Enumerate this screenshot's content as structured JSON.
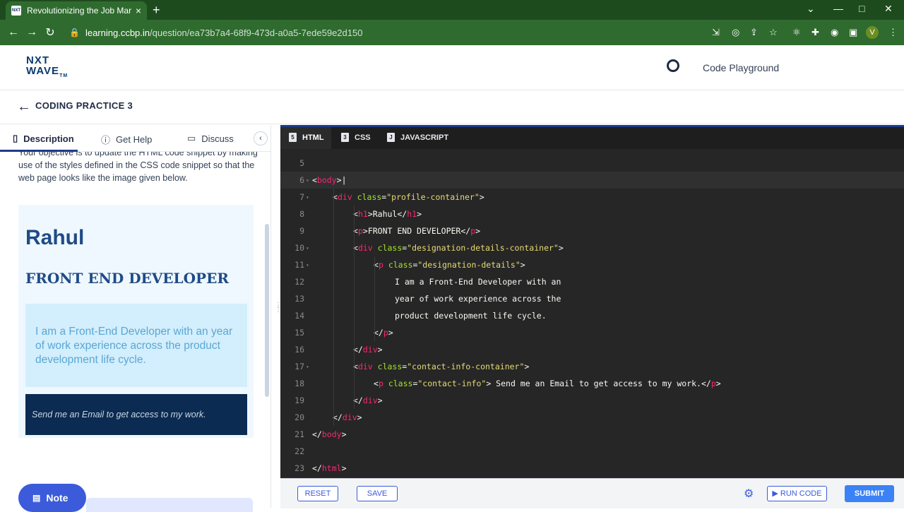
{
  "browser": {
    "tab_title": "Revolutionizing the Job Market |",
    "tab_favicon_text": "NXT",
    "new_tab": "+",
    "close_tab": "×",
    "url_host": "learning.ccbp.in",
    "url_path": "/question/ea73b7a4-68f9-473d-a0a5-7ede59e2d150",
    "profile_initial": "V",
    "controls": {
      "minimize": "—",
      "maximize": "□",
      "close": "✕",
      "dropdown": "⌄"
    },
    "nav": {
      "back": "←",
      "forward": "→",
      "reload": "↻"
    }
  },
  "header": {
    "logo_line1": "NXT",
    "logo_line2": "WAVE",
    "logo_tm": "TM",
    "playground_label": "Code Playground"
  },
  "subheader": {
    "back": "←",
    "title": "CODING PRACTICE 3"
  },
  "left_panel": {
    "tabs": [
      {
        "label": "Description",
        "icon": "document-icon"
      },
      {
        "label": "Get Help",
        "icon": "question-icon"
      },
      {
        "label": "Discuss",
        "icon": "comment-icon"
      }
    ],
    "collapse": "‹",
    "objective_text": "Your objective is to update the HTML code snippet by making use of the styles defined in the CSS code snippet so that the web page looks like the image given below.",
    "preview": {
      "name": "Rahul",
      "role": "FRONT END DEVELOPER",
      "description": "I am a Front-End Developer with an year of work experience across the product development life cycle.",
      "contact": "Send me an Email to get access to my work."
    },
    "note_label": "Note"
  },
  "editor": {
    "tabs": [
      {
        "label": "HTML",
        "icon": "html5-icon"
      },
      {
        "label": "CSS",
        "icon": "css3-icon"
      },
      {
        "label": "JAVASCRIPT",
        "icon": "js-file-icon"
      }
    ],
    "line_numbers": [
      "5",
      "6",
      "7",
      "8",
      "9",
      "10",
      "11",
      "12",
      "13",
      "14",
      "15",
      "16",
      "17",
      "18",
      "19",
      "20",
      "21",
      "22",
      "23"
    ],
    "lines": {
      "l6_open": "<",
      "l6_tag": "body",
      "l6_close": ">",
      "l7_tag": "div",
      "l7_attr": "class",
      "l7_val": "\"profile-container\"",
      "l8_tag": "h1",
      "l8_text": "Rahul",
      "l9_tag": "p",
      "l9_text": "FRONT END DEVELOPER",
      "l10_tag": "div",
      "l10_attr": "class",
      "l10_val": "\"designation-details-container\"",
      "l11_tag": "p",
      "l11_attr": "class",
      "l11_val": "\"designation-details\"",
      "l12_text": "I am a Front-End Developer with an",
      "l13_text": "year of work experience across the",
      "l14_text": "product development life cycle.",
      "l15_tag": "p",
      "l16_tag": "div",
      "l17_tag": "div",
      "l17_attr": "class",
      "l17_val": "\"contact-info-container\"",
      "l18_tag": "p",
      "l18_attr": "class",
      "l18_val": "\"contact-info\"",
      "l18_text": " Send me an Email to get access to my work.",
      "l19_tag": "div",
      "l20_tag": "div",
      "l21_tag": "body",
      "l23_tag": "html"
    }
  },
  "bottom_bar": {
    "reset": "RESET",
    "save": "SAVE",
    "run": "▶ RUN CODE",
    "submit": "SUBMIT",
    "settings_icon": "⚙"
  },
  "colors": {
    "browser_chrome": "#2f6b2f",
    "brand_blue": "#1f4b87",
    "editor_bg": "#262626",
    "tag_pink": "#f92672",
    "attr_green": "#a6e22e",
    "string_yellow": "#e6db74",
    "submit_blue": "#3b82f6"
  }
}
